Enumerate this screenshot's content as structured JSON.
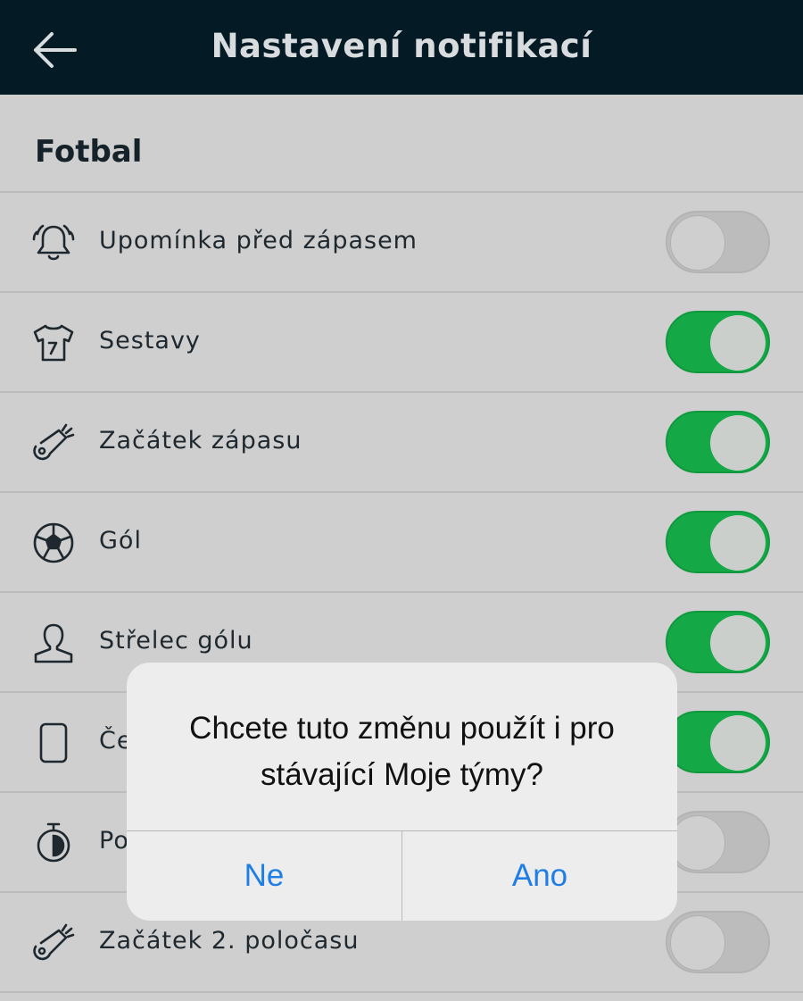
{
  "header": {
    "title": "Nastavení notifikací",
    "back_icon": "arrow-left-icon"
  },
  "section": {
    "title": "Fotbal"
  },
  "rows": [
    {
      "label": "Upomínka před zápasem",
      "icon": "bell-ringing-icon",
      "enabled": false
    },
    {
      "label": "Sestavy",
      "icon": "jersey-icon",
      "enabled": true
    },
    {
      "label": "Začátek zápasu",
      "icon": "whistle-icon",
      "enabled": true
    },
    {
      "label": "Gól",
      "icon": "soccer-ball-icon",
      "enabled": true
    },
    {
      "label": "Střelec gólu",
      "icon": "person-icon",
      "enabled": true
    },
    {
      "label": "Če",
      "icon": "card-icon",
      "enabled": true
    },
    {
      "label": "Po",
      "icon": "stopwatch-icon",
      "enabled": false
    },
    {
      "label": "Začátek 2. poločasu",
      "icon": "whistle-icon",
      "enabled": false
    }
  ],
  "dialog": {
    "message": "Chcete tuto změnu použít i pro stávající Moje týmy?",
    "no_label": "Ne",
    "yes_label": "Ano"
  },
  "colors": {
    "header_bg": "#041a24",
    "toggle_on": "#14a847",
    "dialog_button": "#1f7ee6"
  }
}
